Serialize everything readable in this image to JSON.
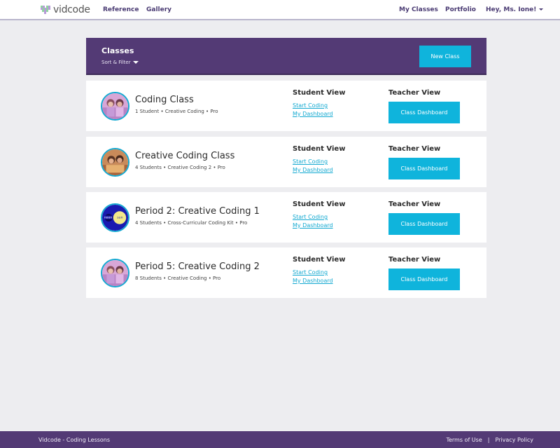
{
  "nav": {
    "logo_text": "vidcode",
    "links": [
      "Reference",
      "Gallery"
    ],
    "right_links": [
      "My Classes",
      "Portfolio"
    ],
    "user_menu": "Hey, Ms. Ione!"
  },
  "classes_header": {
    "title": "Classes",
    "sort_filter": "Sort & Filter",
    "new_class": "New Class"
  },
  "classes": [
    {
      "name": "Coding Class",
      "meta": "1 Student • Creative Coding • Pro",
      "student_view": "Student View",
      "start_coding": "Start Coding",
      "my_dashboard": "My Dashboard",
      "teacher_view": "Teacher View",
      "class_dashboard": "Class Dashboard",
      "avatar": "students-photo"
    },
    {
      "name": "Creative Coding Class",
      "meta": "4 Students • Creative Coding 2 • Pro",
      "student_view": "Student View",
      "start_coding": "Start Coding",
      "my_dashboard": "My Dashboard",
      "teacher_view": "Teacher View",
      "class_dashboard": "Class Dashboard",
      "avatar": "students-photo-orange"
    },
    {
      "name": "Period 2: Creative Coding 1",
      "meta": "4 Students • Cross-Curricular Coding Kit • Pro",
      "student_view": "Student View",
      "start_coding": "Start Coding",
      "my_dashboard": "My Dashboard",
      "teacher_view": "Teacher View",
      "class_dashboard": "Class Dashboard",
      "avatar": "moon-sun-graphic"
    },
    {
      "name": "Period 5: Creative Coding 2",
      "meta": "8 Students • Creative Coding • Pro",
      "student_view": "Student View",
      "start_coding": "Start Coding",
      "my_dashboard": "My Dashboard",
      "teacher_view": "Teacher View",
      "class_dashboard": "Class Dashboard",
      "avatar": "students-photo"
    }
  ],
  "footer": {
    "left": "Vidcode - Coding Lessons",
    "terms": "Terms of Use",
    "separator": "|",
    "privacy": "Privacy Policy"
  },
  "colors": {
    "brand_purple": "#533a75",
    "accent_cyan": "#0fb4dc",
    "background": "#ededf0"
  }
}
